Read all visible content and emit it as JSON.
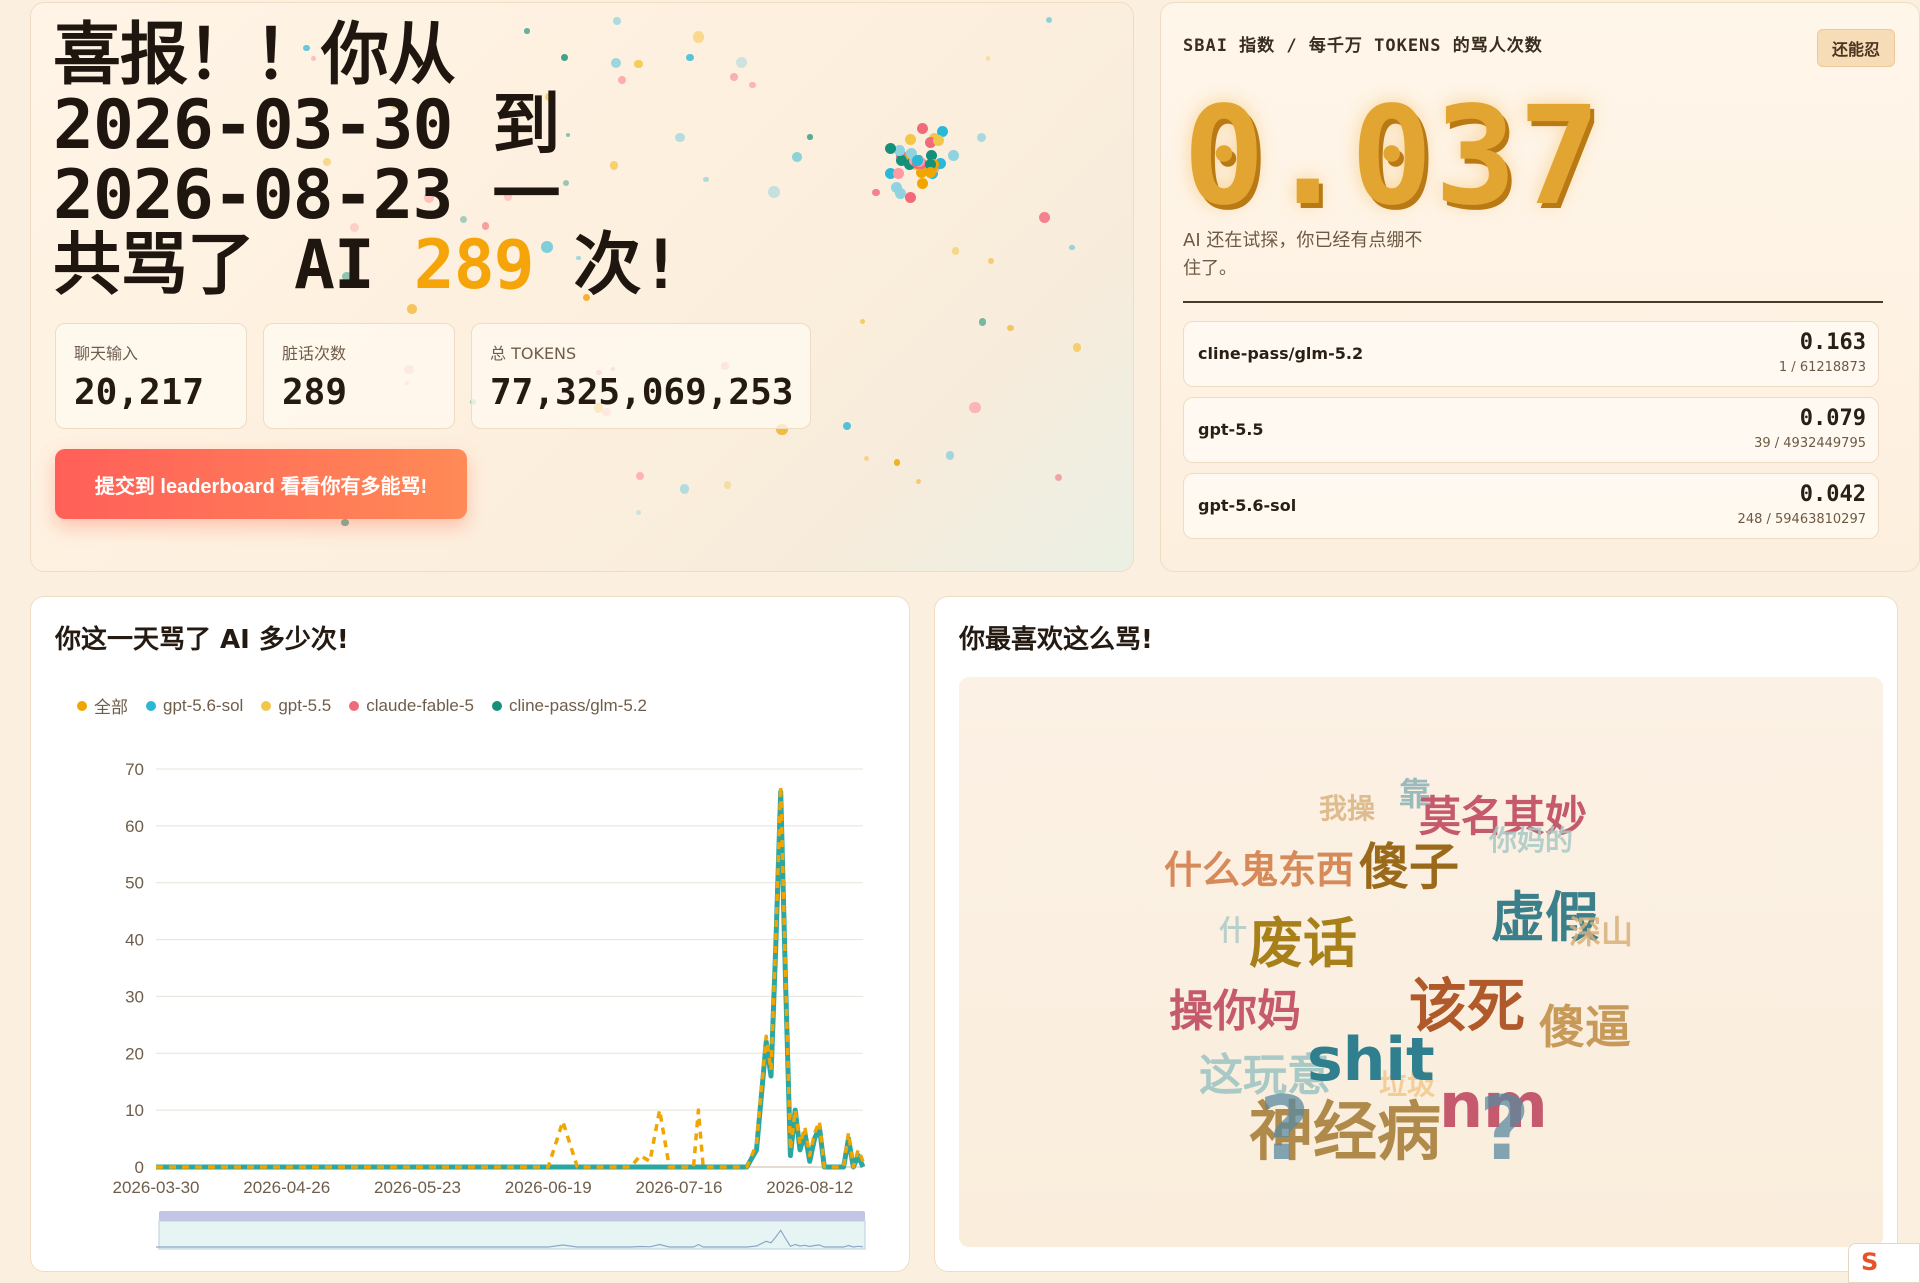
{
  "hero": {
    "title_line1": "喜报！！你从",
    "title_line2": "2026-03-30 到",
    "title_line3": "2026-08-23 一",
    "title_line4_prefix": "共骂了 AI ",
    "title_count": "289",
    "title_line4_suffix": " 次!",
    "stats": [
      {
        "label": "聊天输入",
        "value": "20,217"
      },
      {
        "label": "脏话次数",
        "value": "289"
      },
      {
        "label": "总 TOKENS",
        "value": "77,325,069,253"
      }
    ],
    "cta_label": "提交到 leaderboard 看看你有多能骂!"
  },
  "index": {
    "title": "SBAI 指数 / 每千万 TOKENS 的骂人次数",
    "badge": "还能忍",
    "value": "0.037",
    "description": "AI 还在试探，你已经有点绷不住了。",
    "models": [
      {
        "name": "cline-pass/glm-5.2",
        "score": "0.163",
        "detail": "1 / 61218873"
      },
      {
        "name": "gpt-5.5",
        "score": "0.079",
        "detail": "39 / 4932449795"
      },
      {
        "name": "gpt-5.6-sol",
        "score": "0.042",
        "detail": "248 / 59463810297"
      }
    ]
  },
  "daily": {
    "title": "你这一天骂了 AI 多少次!",
    "legend": [
      {
        "name": "全部",
        "color": "#f0a500"
      },
      {
        "name": "gpt-5.6-sol",
        "color": "#2bb8d6"
      },
      {
        "name": "gpt-5.5",
        "color": "#f3c64a"
      },
      {
        "name": "claude-fable-5",
        "color": "#f06a7a"
      },
      {
        "name": "cline-pass/glm-5.2",
        "color": "#15907a"
      }
    ]
  },
  "chart_data": {
    "type": "line",
    "title": "你这一天骂了 AI 多少次!",
    "ylim": [
      0,
      70
    ],
    "yticks": [
      0,
      10,
      20,
      30,
      40,
      50,
      60,
      70
    ],
    "x_tick_labels": [
      "2026-03-30",
      "2026-04-26",
      "2026-05-23",
      "2026-06-19",
      "2026-07-16",
      "2026-08-12"
    ],
    "x_range": [
      "2026-03-30",
      "2026-08-23"
    ],
    "series": [
      {
        "name": "全部",
        "color": "#f0a500",
        "points": [
          [
            "2026-03-30",
            0
          ],
          [
            "2026-06-19",
            0
          ],
          [
            "2026-06-22",
            8
          ],
          [
            "2026-06-25",
            0
          ],
          [
            "2026-07-06",
            0
          ],
          [
            "2026-07-08",
            2
          ],
          [
            "2026-07-10",
            1
          ],
          [
            "2026-07-12",
            10
          ],
          [
            "2026-07-14",
            0
          ],
          [
            "2026-07-19",
            0
          ],
          [
            "2026-07-20",
            10
          ],
          [
            "2026-07-21",
            0
          ],
          [
            "2026-07-30",
            0
          ],
          [
            "2026-08-01",
            4
          ],
          [
            "2026-08-03",
            23
          ],
          [
            "2026-08-04",
            17
          ],
          [
            "2026-08-05",
            40
          ],
          [
            "2026-08-06",
            67
          ],
          [
            "2026-08-07",
            34
          ],
          [
            "2026-08-08",
            3
          ],
          [
            "2026-08-09",
            10
          ],
          [
            "2026-08-10",
            4
          ],
          [
            "2026-08-11",
            7
          ],
          [
            "2026-08-12",
            2
          ],
          [
            "2026-08-13",
            6
          ],
          [
            "2026-08-14",
            8
          ],
          [
            "2026-08-15",
            0
          ],
          [
            "2026-08-19",
            0
          ],
          [
            "2026-08-20",
            6
          ],
          [
            "2026-08-21",
            0
          ],
          [
            "2026-08-22",
            3
          ],
          [
            "2026-08-23",
            1
          ]
        ]
      },
      {
        "name": "gpt-5.6-sol",
        "color": "#2aa7a0",
        "points": [
          [
            "2026-03-30",
            0
          ],
          [
            "2026-07-30",
            0
          ],
          [
            "2026-08-01",
            3
          ],
          [
            "2026-08-03",
            22
          ],
          [
            "2026-08-04",
            16
          ],
          [
            "2026-08-05",
            39
          ],
          [
            "2026-08-06",
            66
          ],
          [
            "2026-08-07",
            33
          ],
          [
            "2026-08-08",
            2
          ],
          [
            "2026-08-09",
            10
          ],
          [
            "2026-08-10",
            3
          ],
          [
            "2026-08-11",
            6
          ],
          [
            "2026-08-12",
            1
          ],
          [
            "2026-08-13",
            5
          ],
          [
            "2026-08-14",
            7
          ],
          [
            "2026-08-15",
            0
          ],
          [
            "2026-08-19",
            0
          ],
          [
            "2026-08-20",
            5
          ],
          [
            "2026-08-21",
            0
          ],
          [
            "2026-08-22",
            2
          ],
          [
            "2026-08-23",
            0
          ]
        ]
      }
    ]
  },
  "cloud": {
    "title": "你最喜欢这么骂!",
    "words": [
      {
        "text": "我操",
        "color": "#d9b07a"
      },
      {
        "text": "靠",
        "color": "#7aa8b0"
      },
      {
        "text": "莫名其妙",
        "color": "#c55a6e"
      },
      {
        "text": "你妈的",
        "color": "#a8c9c6"
      },
      {
        "text": "什么鬼东西",
        "color": "#d68a5a"
      },
      {
        "text": "傻子",
        "color": "#9a6a1a"
      },
      {
        "text": "虚假",
        "color": "#3a7f8a"
      },
      {
        "text": "深山",
        "color": "#d9b07a"
      },
      {
        "text": "什",
        "color": "#a8c9c6"
      },
      {
        "text": "废话",
        "color": "#a8801a"
      },
      {
        "text": "操你妈",
        "color": "#c55a6e"
      },
      {
        "text": "该死",
        "color": "#b0592a"
      },
      {
        "text": "傻逼",
        "color": "#c89a5a"
      },
      {
        "text": "垃圾",
        "color": "#f0c078"
      },
      {
        "text": "这玩意",
        "color": "#a8c9c6"
      },
      {
        "text": "shit",
        "color": "#2f7f8f"
      },
      {
        "text": "神经病",
        "color": "#b08a4a"
      },
      {
        "text": "nm",
        "color": "#c55a6e"
      },
      {
        "text": "?",
        "color": "#5a8aa0"
      },
      {
        "text": "?",
        "color": "#5a8aa0"
      }
    ]
  },
  "corner": {
    "label": "S"
  }
}
